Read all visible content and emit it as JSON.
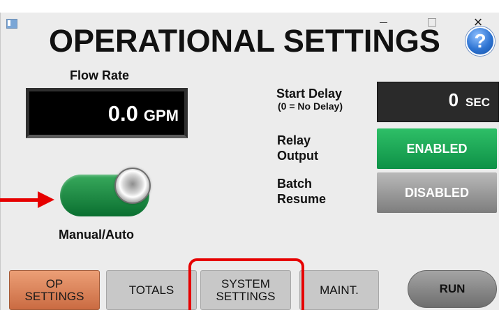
{
  "window": {
    "controls": {
      "minimize": "–",
      "maximize": "□",
      "close": "×"
    }
  },
  "header": {
    "title": "OPERATIONAL SETTINGS",
    "help": "?"
  },
  "flow_rate": {
    "label": "Flow Rate",
    "value": "0.0",
    "unit": "GPM"
  },
  "mode_toggle": {
    "label": "Manual/Auto"
  },
  "start_delay": {
    "label": "Start Delay",
    "sublabel": "(0 = No Delay)",
    "value": "0",
    "unit": "SEC"
  },
  "relay_output": {
    "label_line1": "Relay",
    "label_line2": "Output",
    "state": "ENABLED",
    "state_color": "#12a24f"
  },
  "batch_resume": {
    "label_line1": "Batch",
    "label_line2": "Resume",
    "state": "DISABLED",
    "state_color": "#8a8a8a"
  },
  "nav": {
    "op_line1": "OP",
    "op_line2": "SETTINGS",
    "totals": "TOTALS",
    "system_line1": "SYSTEM",
    "system_line2": "SETTINGS",
    "maint": "MAINT.",
    "run": "RUN"
  },
  "colors": {
    "annotation": "#e60000",
    "toggle_on": "#13833b",
    "op_active": "#e08a5f"
  },
  "icons": {
    "app": "app-window-icon",
    "help": "help-icon",
    "arrow": "annotation-arrow-icon"
  }
}
